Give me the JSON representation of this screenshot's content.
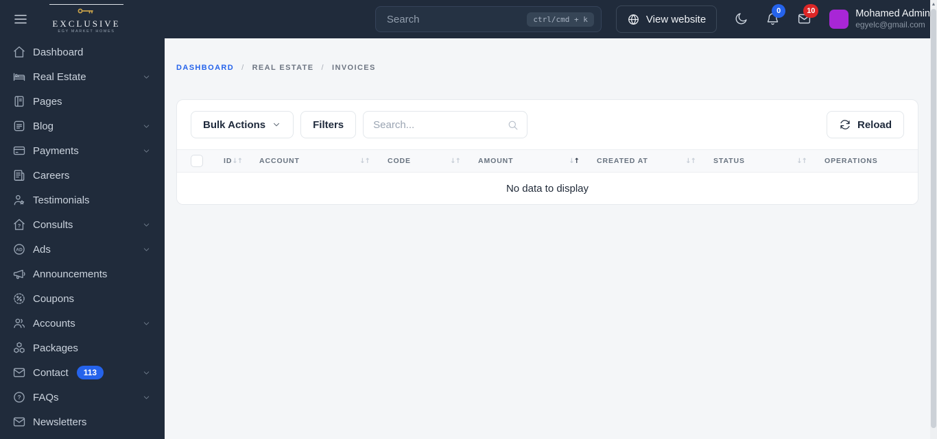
{
  "colors": {
    "navbar_bg": "#202b3b",
    "accent_blue": "#2563eb",
    "badge_red": "#dc2626",
    "avatar_purple": "#a826d6",
    "main_bg": "#f4f6f8"
  },
  "navbar": {
    "logo": {
      "title": "EXCLUSIVE",
      "tagline": "EGY MARKET HOMES"
    },
    "search": {
      "placeholder": "Search",
      "shortcut": "ctrl/cmd + k"
    },
    "view_website_label": "View website",
    "notifications_count": "0",
    "messages_count": "10",
    "user": {
      "name": "Mohamed Admin",
      "email": "egyelc@gmail.com"
    }
  },
  "sidebar": {
    "items": [
      {
        "label": "Dashboard",
        "icon": "home-icon",
        "expandable": false
      },
      {
        "label": "Real Estate",
        "icon": "real-estate-icon",
        "expandable": true
      },
      {
        "label": "Pages",
        "icon": "pages-icon",
        "expandable": false
      },
      {
        "label": "Blog",
        "icon": "blog-icon",
        "expandable": true
      },
      {
        "label": "Payments",
        "icon": "payments-icon",
        "expandable": true
      },
      {
        "label": "Careers",
        "icon": "careers-icon",
        "expandable": false
      },
      {
        "label": "Testimonials",
        "icon": "testimonials-icon",
        "expandable": false
      },
      {
        "label": "Consults",
        "icon": "consults-icon",
        "expandable": true
      },
      {
        "label": "Ads",
        "icon": "ads-icon",
        "expandable": true
      },
      {
        "label": "Announcements",
        "icon": "announcements-icon",
        "expandable": false
      },
      {
        "label": "Coupons",
        "icon": "coupons-icon",
        "expandable": false
      },
      {
        "label": "Accounts",
        "icon": "accounts-icon",
        "expandable": true
      },
      {
        "label": "Packages",
        "icon": "packages-icon",
        "expandable": false
      },
      {
        "label": "Contact",
        "icon": "contact-icon",
        "expandable": true,
        "badge": "113"
      },
      {
        "label": "FAQs",
        "icon": "faqs-icon",
        "expandable": true
      },
      {
        "label": "Newsletters",
        "icon": "newsletters-icon",
        "expandable": false
      }
    ]
  },
  "breadcrumb": {
    "items": [
      "DASHBOARD",
      "REAL ESTATE",
      "INVOICES"
    ],
    "separator": "/"
  },
  "toolbar": {
    "bulk_actions_label": "Bulk Actions",
    "filters_label": "Filters",
    "search_placeholder": "Search...",
    "reload_label": "Reload"
  },
  "table": {
    "columns": [
      {
        "label": "ID",
        "sortable": true
      },
      {
        "label": "ACCOUNT",
        "sortable": true
      },
      {
        "label": "CODE",
        "sortable": true
      },
      {
        "label": "AMOUNT",
        "sortable": true,
        "sorted": "asc"
      },
      {
        "label": "CREATED AT",
        "sortable": true
      },
      {
        "label": "STATUS",
        "sortable": true
      },
      {
        "label": "OPERATIONS",
        "sortable": false
      }
    ],
    "empty_message": "No data to display"
  }
}
